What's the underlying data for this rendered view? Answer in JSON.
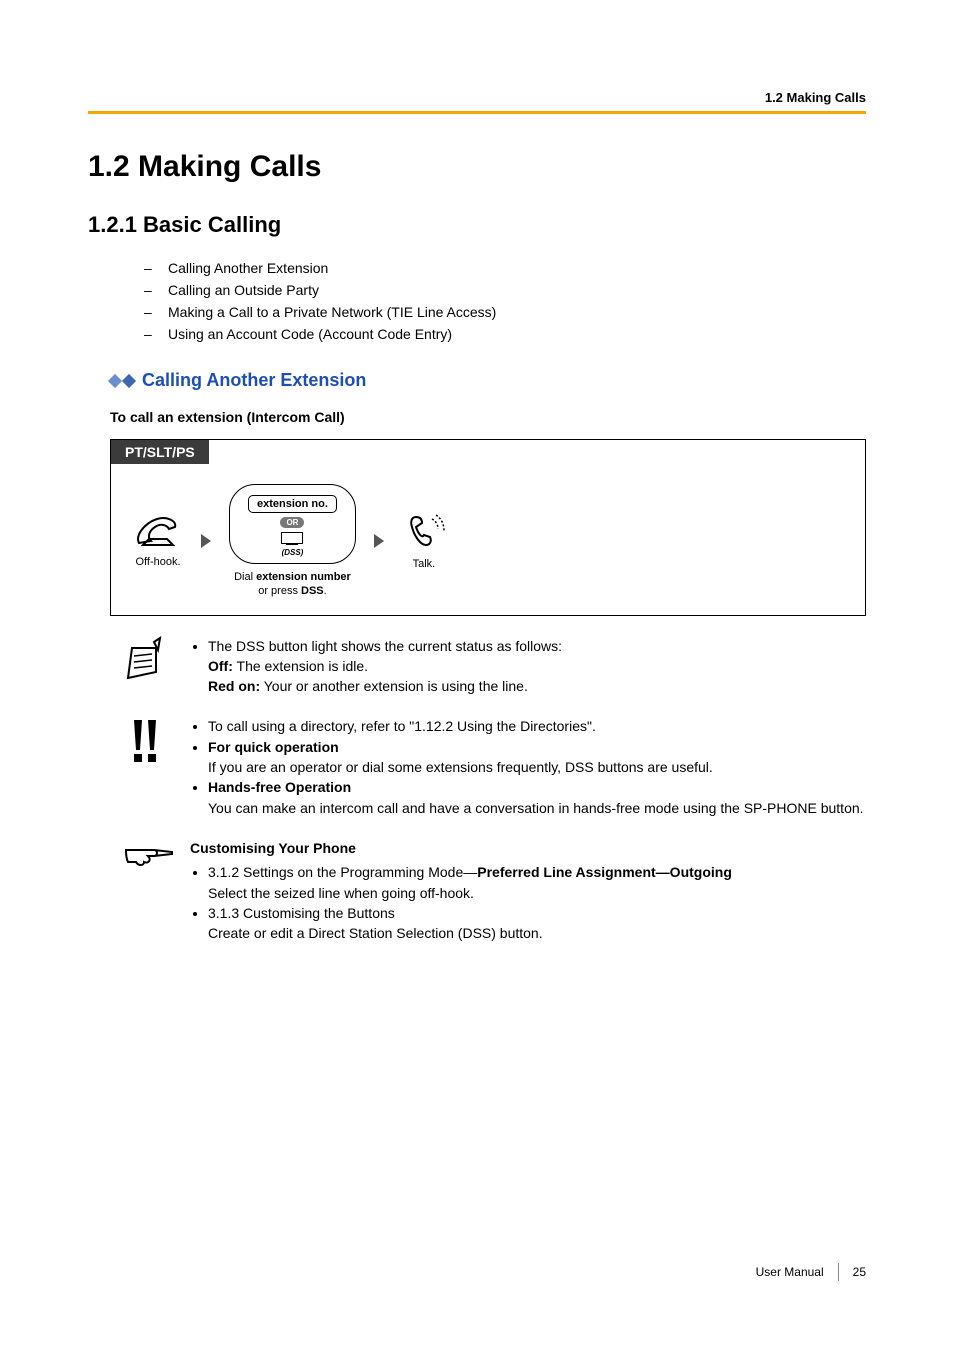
{
  "header": {
    "breadcrumb": "1.2 Making Calls"
  },
  "section": {
    "title": "1.2    Making Calls",
    "sub_title": "1.2.1    Basic Calling",
    "dash_items": [
      "Calling Another Extension",
      "Calling an Outside Party",
      "Making a Call to a Private Network (TIE Line Access)",
      "Using an Account Code (Account Code Entry)"
    ]
  },
  "topic": {
    "heading": "Calling Another Extension",
    "procedure_title": "To call an extension (Intercom Call)"
  },
  "procedure": {
    "tab": "PT/SLT/PS",
    "step1_caption": "Off-hook.",
    "ext_label": "extension no.",
    "or_label": "OR",
    "dss_label": "(DSS)",
    "step2_caption_pre": "Dial ",
    "step2_caption_bold1": "extension number",
    "step2_caption_mid": "\nor press ",
    "step2_caption_bold2": "DSS",
    "step2_caption_post": ".",
    "step3_caption": "Talk."
  },
  "note1": {
    "line1": "The DSS button light shows the current status as follows:",
    "off_label": "Off:",
    "off_text": " The extension is idle.",
    "red_label": "Red on:",
    "red_text": " Your or another extension is using the line."
  },
  "note2": {
    "line1": "To call using a directory, refer to \"1.12.2 Using the Directories\".",
    "quick_label": "For quick operation",
    "quick_text": "If you are an operator or dial some extensions frequently, DSS buttons are useful.",
    "hands_label": "Hands-free Operation",
    "hands_text": "You can make an intercom call and have a conversation in hands-free mode using the SP-PHONE button."
  },
  "note3": {
    "heading": "Customising Your Phone",
    "item1_pre": "3.1.2 Settings on the Programming Mode—",
    "item1_bold": "Preferred Line Assignment—Outgoing",
    "item1_text": "Select the seized line when going off-hook.",
    "item2_title": "3.1.3 Customising the Buttons",
    "item2_text": "Create or edit a Direct Station Selection (DSS) button."
  },
  "footer": {
    "manual": "User Manual",
    "page": "25"
  }
}
